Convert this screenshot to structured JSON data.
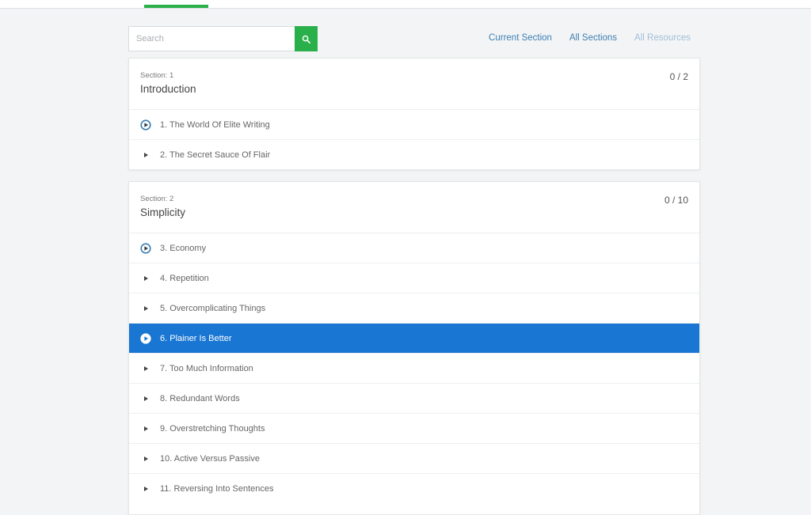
{
  "search": {
    "placeholder": "Search"
  },
  "filters": {
    "current_section": "Current Section",
    "all_sections": "All Sections",
    "all_resources": "All Resources"
  },
  "sections": [
    {
      "label": "Section: 1",
      "title": "Introduction",
      "progress": "0 / 2",
      "lessons": [
        {
          "title": "1. The World Of Elite Writing",
          "icon": "play-circle-icon"
        },
        {
          "title": "2. The Secret Sauce Of Flair",
          "icon": "play-icon"
        }
      ]
    },
    {
      "label": "Section: 2",
      "title": "Simplicity",
      "progress": "0 / 10",
      "lessons": [
        {
          "title": "3. Economy",
          "icon": "play-circle-icon"
        },
        {
          "title": "4. Repetition",
          "icon": "play-icon"
        },
        {
          "title": "5. Overcomplicating Things",
          "icon": "play-icon"
        },
        {
          "title": "6. Plainer Is Better",
          "icon": "play-circle-icon",
          "active": true
        },
        {
          "title": "7. Too Much Information",
          "icon": "play-icon"
        },
        {
          "title": "8. Redundant Words",
          "icon": "play-icon"
        },
        {
          "title": "9. Overstretching Thoughts",
          "icon": "play-icon"
        },
        {
          "title": "10. Active Versus Passive",
          "icon": "play-icon"
        },
        {
          "title": "11. Reversing Into Sentences",
          "icon": "play-icon"
        }
      ]
    }
  ],
  "colors": {
    "accent_green": "#2ab04a",
    "active_row": "#1976d2",
    "link_blue": "#3b7fb4"
  }
}
